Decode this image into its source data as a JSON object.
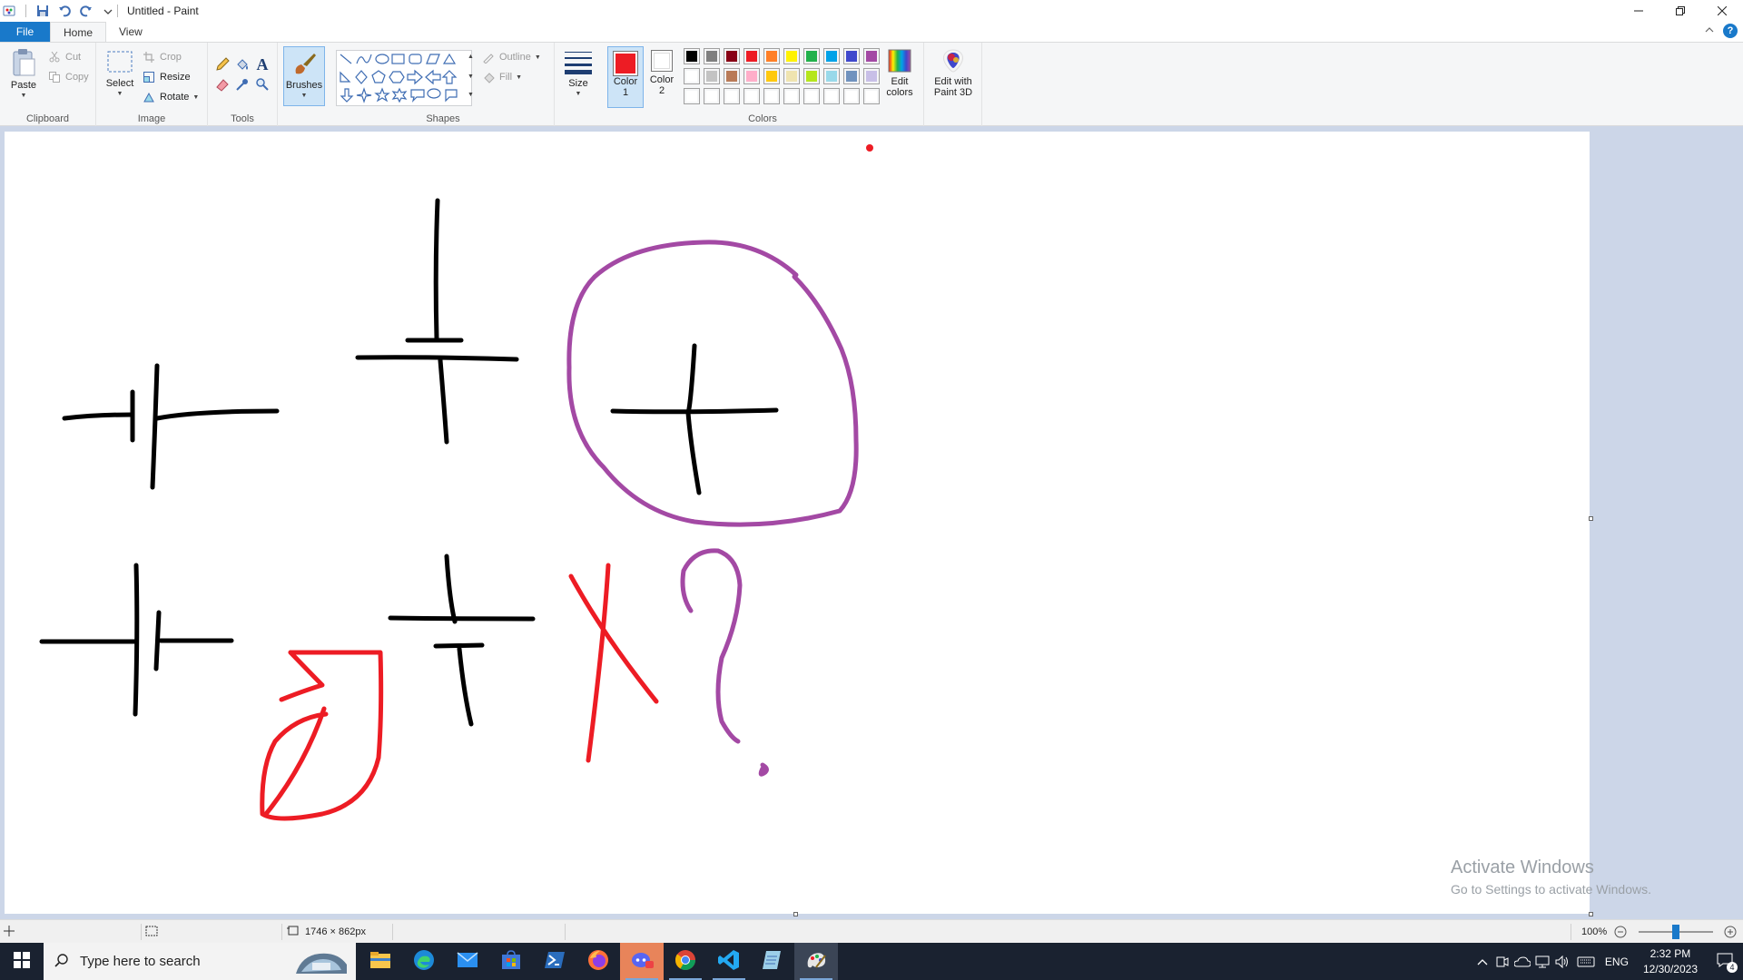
{
  "window": {
    "title": "Untitled - Paint",
    "controls": [
      "minimize-icon",
      "restore-icon",
      "close-icon"
    ]
  },
  "tabs": [
    "File",
    "Home",
    "View"
  ],
  "ribbon": {
    "clipboard": {
      "label": "Clipboard",
      "paste": "Paste",
      "cut": "Cut",
      "copy": "Copy"
    },
    "image": {
      "label": "Image",
      "select": "Select",
      "crop": "Crop",
      "resize": "Resize",
      "rotate": "Rotate"
    },
    "tools": {
      "label": "Tools"
    },
    "brushes": {
      "label": "Brushes"
    },
    "shapes": {
      "label": "Shapes",
      "outline": "Outline",
      "fill": "Fill"
    },
    "size": {
      "label": "Size"
    },
    "colors": {
      "label": "Colors",
      "color1": "Color",
      "color1_num": "1",
      "color2": "Color",
      "color2_num": "2",
      "edit_colors_1": "Edit",
      "edit_colors_2": "colors",
      "paint3d_1": "Edit with",
      "paint3d_2": "Paint 3D",
      "color1_value": "#ed1c24",
      "color2_value": "#ffffff",
      "palette_row1": [
        "#000000",
        "#7f7f7f",
        "#880015",
        "#ed1c24",
        "#ff7f27",
        "#fff200",
        "#22b14c",
        "#00a2e8",
        "#3f48cc",
        "#a349a4"
      ],
      "palette_row2": [
        "#ffffff",
        "#c3c3c3",
        "#b97a57",
        "#ffaec9",
        "#ffc90e",
        "#efe4b0",
        "#b5e61d",
        "#99d9ea",
        "#7092be",
        "#c8bfe7"
      ],
      "palette_row3": [
        "#ffffff",
        "#ffffff",
        "#ffffff",
        "#ffffff",
        "#ffffff",
        "#ffffff",
        "#ffffff",
        "#ffffff",
        "#ffffff",
        "#ffffff"
      ]
    }
  },
  "drawing_colors": {
    "black": "#000000",
    "purple": "#a349a4",
    "red": "#ed1c24"
  },
  "watermark": {
    "line1": "Activate Windows",
    "line2": "Go to Settings to activate Windows."
  },
  "status": {
    "dimensions": "1746 × 862px",
    "zoom": "100%",
    "zoom_level": 1.0
  },
  "taskbar": {
    "search_placeholder": "Type here to search",
    "apps": [
      "file-explorer",
      "edge",
      "mail",
      "store",
      "terminal",
      "firefox",
      "discord",
      "chrome",
      "vscode",
      "notepad",
      "paint"
    ],
    "language": "ENG",
    "time": "2:32 PM",
    "date": "12/30/2023",
    "notifications": "4"
  }
}
